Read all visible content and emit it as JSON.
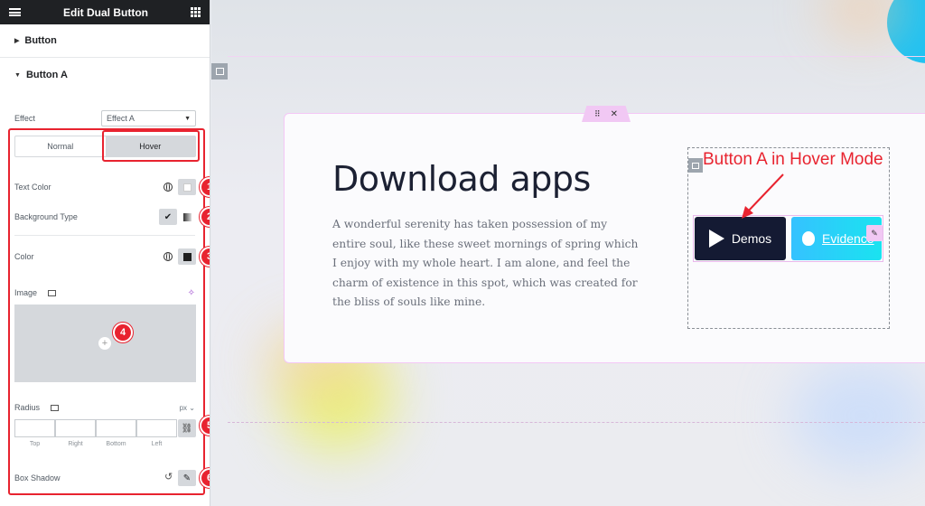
{
  "sidebar": {
    "title": "Edit Dual Button",
    "sections": {
      "button": "Button",
      "button_a": "Button A"
    },
    "effect": {
      "label": "Effect",
      "value": "Effect A"
    },
    "tabs": {
      "normal": "Normal",
      "hover": "Hover"
    },
    "text_color": {
      "label": "Text Color"
    },
    "background_type": {
      "label": "Background Type"
    },
    "color": {
      "label": "Color",
      "value": "#1f1f1f"
    },
    "image": {
      "label": "Image"
    },
    "radius": {
      "label": "Radius",
      "unit": "px",
      "fields": [
        "Top",
        "Right",
        "Bottom",
        "Left"
      ]
    },
    "box_shadow": {
      "label": "Box Shadow"
    },
    "badges": [
      "1",
      "2",
      "3",
      "4",
      "5",
      "6"
    ]
  },
  "canvas": {
    "heading": "Download apps",
    "paragraph": "A wonderful serenity has taken possession of my entire soul, like these sweet mornings of spring which I enjoy with my whole heart. I am alone, and feel the charm of existence in this spot, which was created for the bliss of souls like mine.",
    "button_a": {
      "label": "Demos",
      "color": "#141a33"
    },
    "button_b": {
      "label": "Evidence"
    },
    "annotation": "Button A in Hover Mode",
    "accent": "#e8232f"
  }
}
